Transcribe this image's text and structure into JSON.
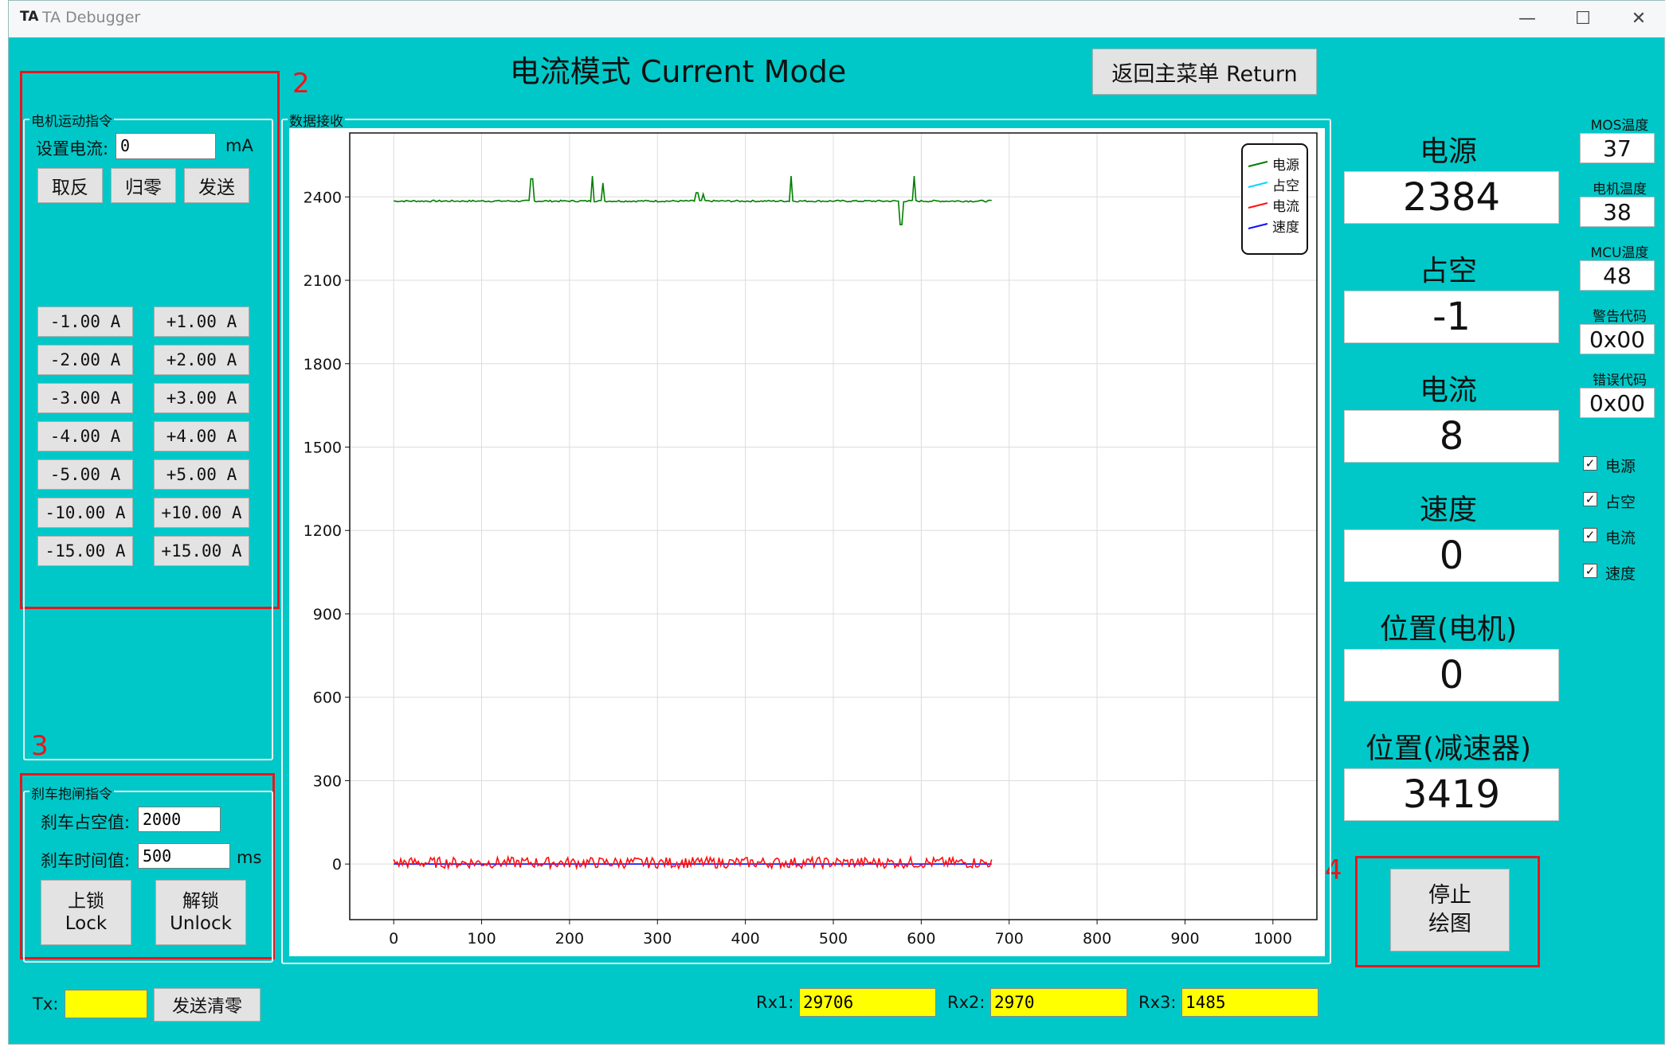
{
  "window": {
    "icon_text": "TA",
    "title": "TA Debugger",
    "minimize": "—",
    "maximize": "☐",
    "close": "✕"
  },
  "header": {
    "title": "电流模式 Current Mode",
    "return_button": "返回主菜单 Return"
  },
  "annotations": [
    "2",
    "3",
    "4"
  ],
  "motor_group": {
    "title": "电机运动指令",
    "set_current_label": "设置电流:",
    "set_current_value": "0",
    "set_current_unit": "mA",
    "invert_button": "取反",
    "zero_button": "归零",
    "send_button": "发送",
    "presets_negative": [
      "-1.00 A",
      "-2.00 A",
      "-3.00 A",
      "-4.00 A",
      "-5.00 A",
      "-10.00 A",
      "-15.00 A"
    ],
    "presets_positive": [
      "+1.00 A",
      "+2.00 A",
      "+3.00 A",
      "+4.00 A",
      "+5.00 A",
      "+10.00 A",
      "+15.00 A"
    ]
  },
  "brake_group": {
    "title": "刹车抱闸指令",
    "duty_label": "刹车占空值:",
    "duty_value": "2000",
    "time_label": "刹车时间值:",
    "time_value": "500",
    "time_unit": "ms",
    "lock_button": {
      "line1": "上锁",
      "line2": "Lock"
    },
    "unlock_button": {
      "line1": "解锁",
      "line2": "Unlock"
    }
  },
  "chart_group_title": "数据接收",
  "chart_data": {
    "type": "line",
    "xlim": [
      -50,
      1050
    ],
    "ylim": [
      -200,
      2630
    ],
    "x_ticks": [
      0,
      100,
      200,
      300,
      400,
      500,
      600,
      700,
      800,
      900,
      1000
    ],
    "y_ticks": [
      0,
      300,
      600,
      900,
      1200,
      1500,
      1800,
      2100,
      2400
    ],
    "grid": true,
    "legend_position": "top-right",
    "series": [
      {
        "name": "电源",
        "color": "#007f00",
        "x_range": [
          0,
          680
        ],
        "base": 2385,
        "noise": 3,
        "spikes": [
          [
            157,
            2465
          ],
          [
            226,
            2475
          ],
          [
            238,
            2450
          ],
          [
            345,
            2415
          ],
          [
            352,
            2410
          ],
          [
            452,
            2475
          ],
          [
            577,
            2300
          ],
          [
            592,
            2475
          ]
        ]
      },
      {
        "name": "占空",
        "color": "#00d8ff",
        "x_range": [
          0,
          680
        ],
        "base": 0,
        "noise": 0,
        "spikes": []
      },
      {
        "name": "电流",
        "color": "#ff1010",
        "x_range": [
          0,
          680
        ],
        "base": 5,
        "noise": 20,
        "spikes": []
      },
      {
        "name": "速度",
        "color": "#1010ff",
        "x_range": [
          0,
          680
        ],
        "base": 0,
        "noise": 0,
        "spikes": []
      }
    ]
  },
  "readouts": [
    {
      "label": "电源",
      "value": "2384"
    },
    {
      "label": "占空",
      "value": "-1"
    },
    {
      "label": "电流",
      "value": "8"
    },
    {
      "label": "速度",
      "value": "0"
    },
    {
      "label": "位置(电机)",
      "value": "0"
    },
    {
      "label": "位置(减速器)",
      "value": "3419"
    }
  ],
  "status": [
    {
      "label": "MOS温度",
      "value": "37"
    },
    {
      "label": "电机温度",
      "value": "38"
    },
    {
      "label": "MCU温度",
      "value": "48"
    },
    {
      "label": "警告代码",
      "value": "0x00"
    },
    {
      "label": "错误代码",
      "value": "0x00"
    }
  ],
  "plot_toggles": [
    {
      "label": "电源",
      "checked": true
    },
    {
      "label": "占空",
      "checked": true
    },
    {
      "label": "电流",
      "checked": true
    },
    {
      "label": "速度",
      "checked": true
    }
  ],
  "stop_plot_button": {
    "line1": "停止",
    "line2": "绘图"
  },
  "footer": {
    "tx_label": "Tx:",
    "tx_value": "",
    "clear_button": "发送清零",
    "rx1_label": "Rx1:",
    "rx1_value": "29706",
    "rx2_label": "Rx2:",
    "rx2_value": "2970",
    "rx3_label": "Rx3:",
    "rx3_value": "1485"
  }
}
